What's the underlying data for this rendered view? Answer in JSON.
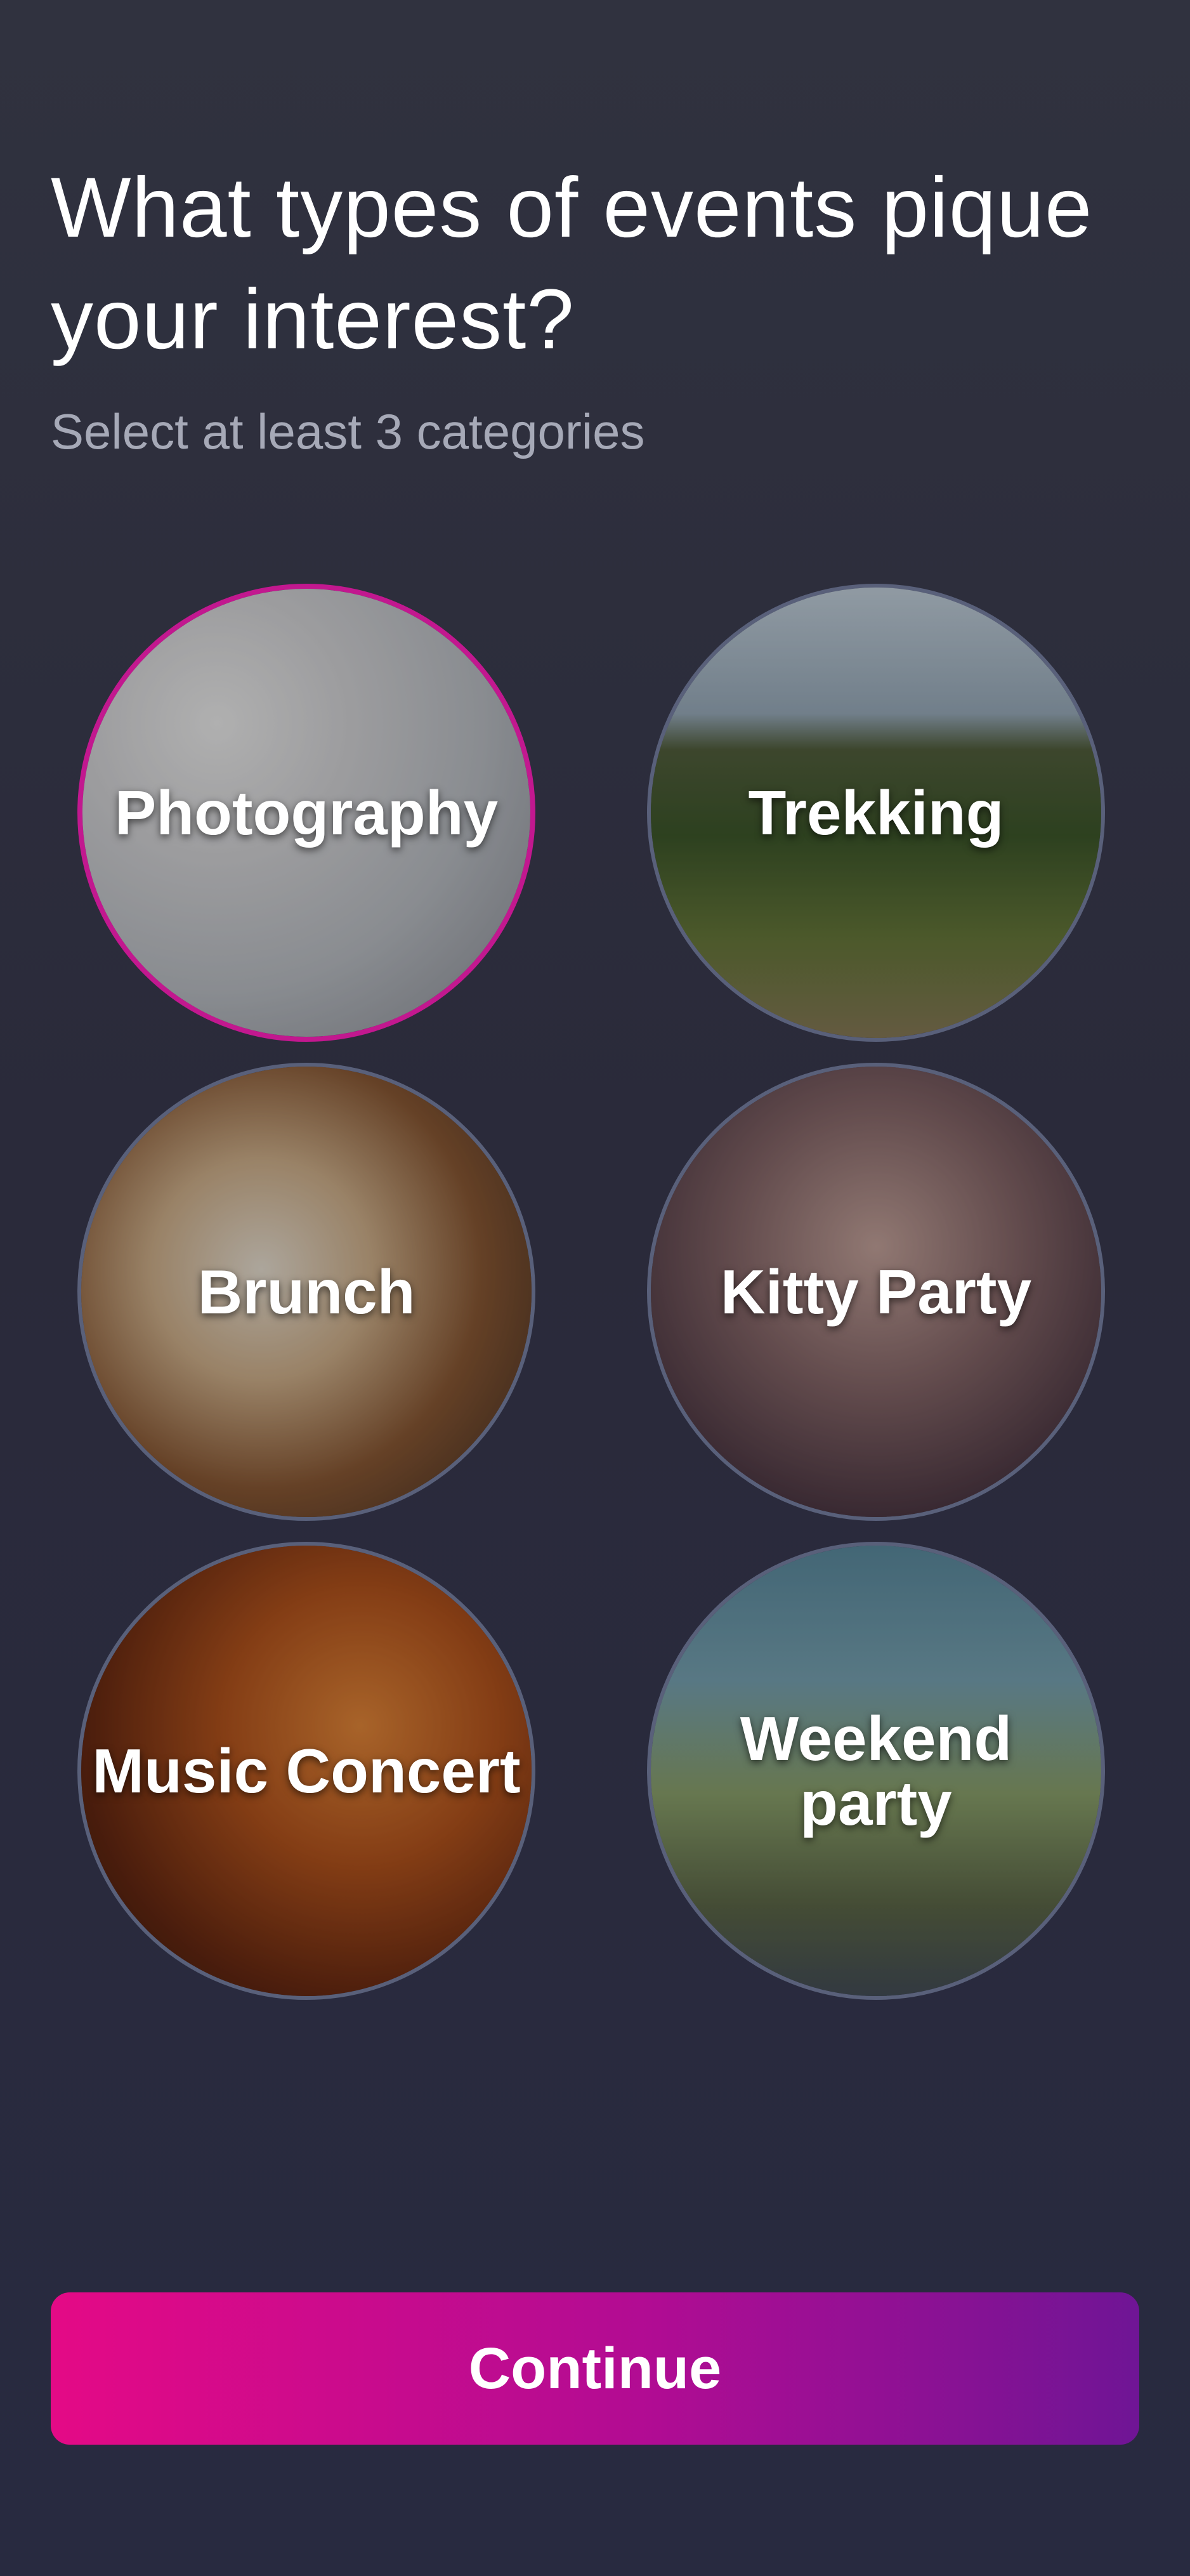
{
  "header": {
    "title": "What types of events pique your interest?",
    "subtitle": "Select at least 3 categories"
  },
  "categories": [
    {
      "label": "Photography",
      "selected": true
    },
    {
      "label": "Trekking",
      "selected": false
    },
    {
      "label": "Brunch",
      "selected": false
    },
    {
      "label": "Kitty Party",
      "selected": false
    },
    {
      "label": "Music Concert",
      "selected": false
    },
    {
      "label": "Weekend party",
      "selected": false
    }
  ],
  "footer": {
    "continue_label": "Continue"
  },
  "colors": {
    "accent_start": "#e40a86",
    "accent_end": "#6f1595",
    "selected_border": "#c2188f",
    "unselected_border": "#59607a"
  }
}
